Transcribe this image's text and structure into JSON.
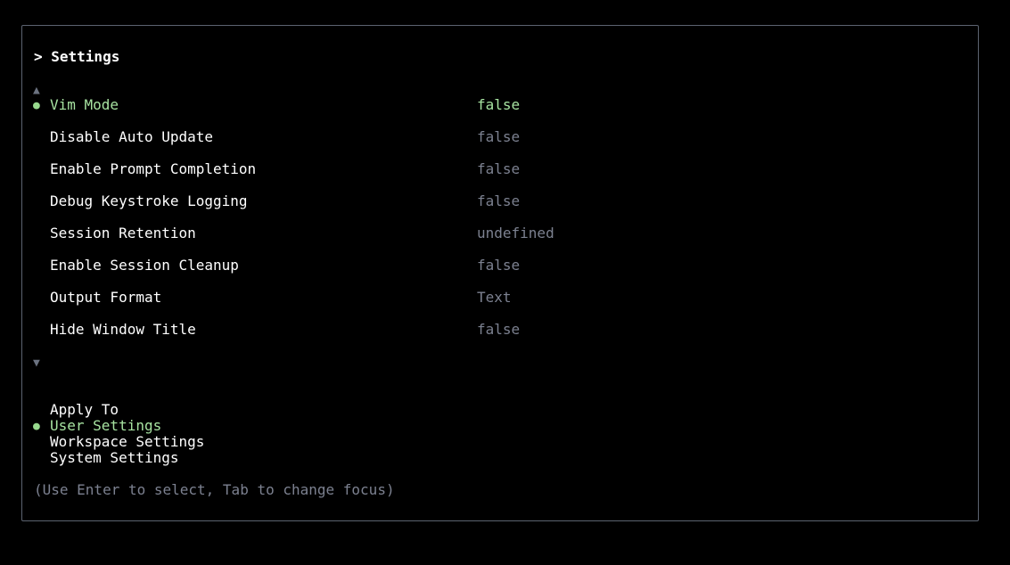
{
  "header": {
    "title": "> Settings"
  },
  "scroll": {
    "up_icon": "▲",
    "down_icon": "▼"
  },
  "bullet_icon": "●",
  "settings": [
    {
      "label": "Vim Mode",
      "value": "false",
      "active": true
    },
    {
      "label": "Disable Auto Update",
      "value": "false"
    },
    {
      "label": "Enable Prompt Completion",
      "value": "false"
    },
    {
      "label": "Debug Keystroke Logging",
      "value": "false"
    },
    {
      "label": "Session Retention",
      "value": "undefined"
    },
    {
      "label": "Enable Session Cleanup",
      "value": "false"
    },
    {
      "label": "Output Format",
      "value": "Text"
    },
    {
      "label": "Hide Window Title",
      "value": "false"
    }
  ],
  "apply_to": {
    "heading": "Apply To",
    "options": [
      {
        "label": "User Settings",
        "selected": true
      },
      {
        "label": "Workspace Settings"
      },
      {
        "label": "System Settings"
      }
    ]
  },
  "hint": "(Use Enter to select, Tab to change focus)",
  "colors": {
    "background": "#000000",
    "border": "#5c6370",
    "active_green": "#a7e3a1",
    "muted": "#7c8190"
  }
}
